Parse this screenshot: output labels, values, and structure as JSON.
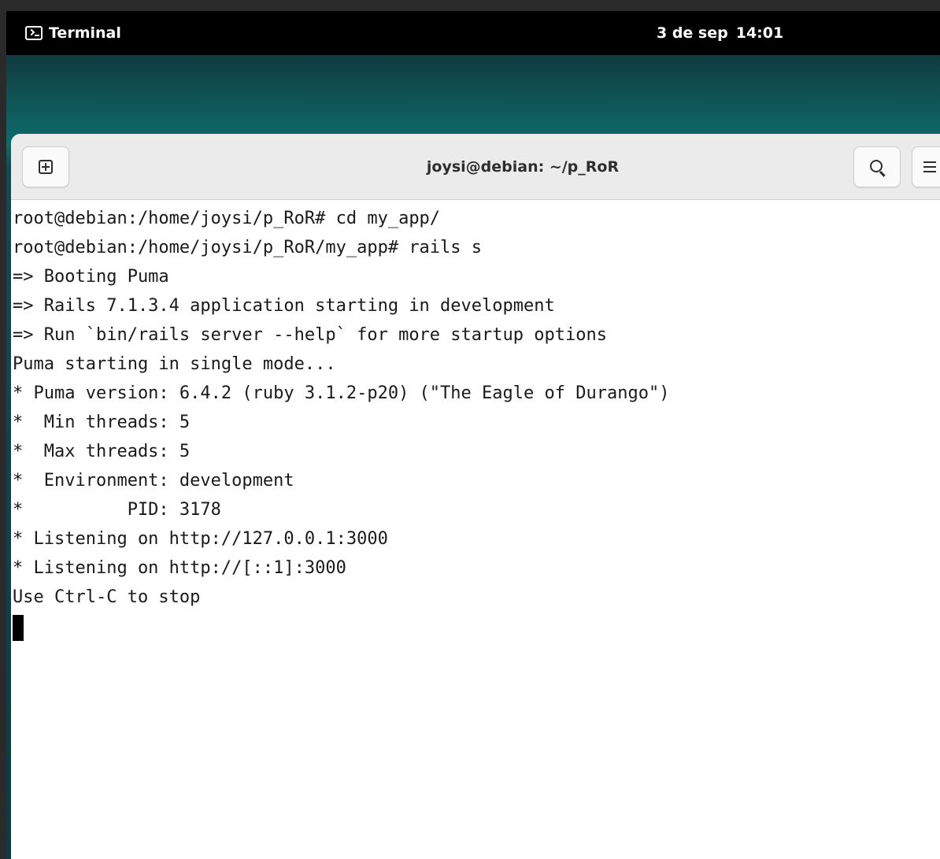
{
  "topbar": {
    "app_name": "Terminal",
    "app_icon": "terminal-icon",
    "date": "3 de sep",
    "time": "14:01"
  },
  "window": {
    "title": "joysi@debian: ~/p_RoR",
    "buttons": {
      "new_tab_icon": "new-tab-icon",
      "search_icon": "search-icon",
      "menu_icon": "hamburger-menu-icon"
    }
  },
  "terminal": {
    "lines": [
      "root@debian:/home/joysi/p_RoR# cd my_app/",
      "root@debian:/home/joysi/p_RoR/my_app# rails s",
      "=> Booting Puma",
      "=> Rails 7.1.3.4 application starting in development",
      "=> Run `bin/rails server --help` for more startup options",
      "Puma starting in single mode...",
      "* Puma version: 6.4.2 (ruby 3.1.2-p20) (\"The Eagle of Durango\")",
      "*  Min threads: 5",
      "*  Max threads: 5",
      "*  Environment: development",
      "*          PID: 3178",
      "* Listening on http://127.0.0.1:3000",
      "* Listening on http://[::1]:3000",
      "Use Ctrl-C to stop"
    ]
  },
  "colors": {
    "topbar_bg": "#000000",
    "desktop_accent": "#0e6a68",
    "headerbar_bg": "#ebebeb",
    "terminal_bg": "#ffffff",
    "terminal_fg": "#1a1a1a"
  }
}
